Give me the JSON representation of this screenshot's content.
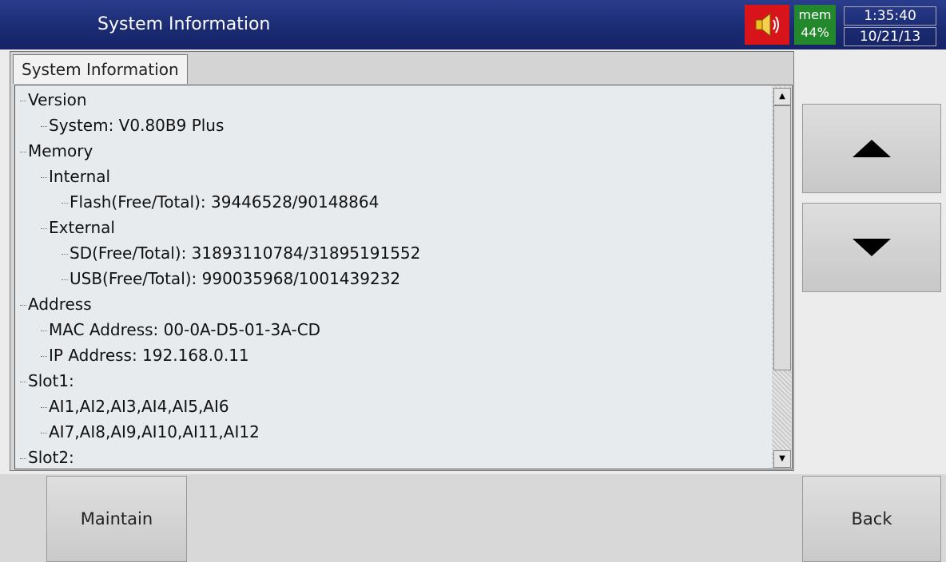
{
  "header": {
    "title": "System Information",
    "mem_label": "mem",
    "mem_percent": "44%",
    "time": "1:35:40",
    "date": "10/21/13",
    "alarm_icon": "speaker-icon"
  },
  "tab": {
    "label": "System Information"
  },
  "tree": [
    {
      "text": "Version",
      "depth": 0
    },
    {
      "text": "System: V0.80B9 Plus",
      "depth": 1
    },
    {
      "text": "Memory",
      "depth": 0
    },
    {
      "text": "Internal",
      "depth": 1
    },
    {
      "text": "Flash(Free/Total): 39446528/90148864",
      "depth": 2
    },
    {
      "text": "External",
      "depth": 1
    },
    {
      "text": "SD(Free/Total): 31893110784/31895191552",
      "depth": 2
    },
    {
      "text": "USB(Free/Total): 990035968/1001439232",
      "depth": 2
    },
    {
      "text": "Address",
      "depth": 0
    },
    {
      "text": "MAC Address: 00-0A-D5-01-3A-CD",
      "depth": 1
    },
    {
      "text": "IP Address: 192.168.0.11",
      "depth": 1
    },
    {
      "text": "Slot1:",
      "depth": 0
    },
    {
      "text": "AI1,AI2,AI3,AI4,AI5,AI6",
      "depth": 1
    },
    {
      "text": "AI7,AI8,AI9,AI10,AI11,AI12",
      "depth": 1
    },
    {
      "text": "Slot2:",
      "depth": 0
    }
  ],
  "buttons": {
    "maintain": "Maintain",
    "back": "Back",
    "up_icon": "arrow-up-icon",
    "down_icon": "arrow-down-icon"
  },
  "colors": {
    "titlebar": "#1a2a72",
    "alarm": "#d8141a",
    "mem": "#23872c"
  }
}
